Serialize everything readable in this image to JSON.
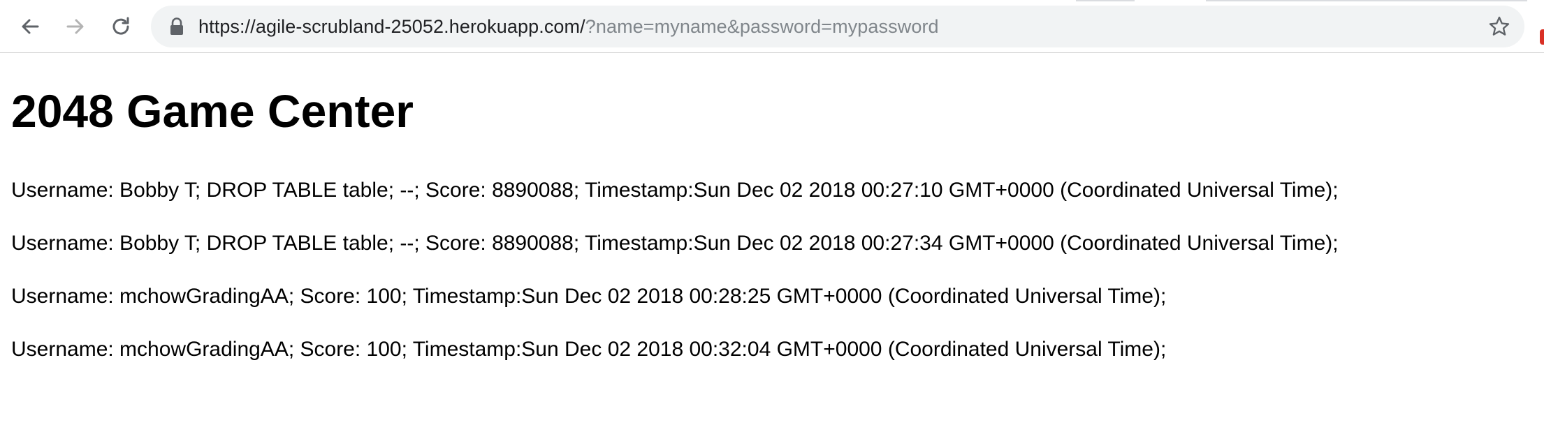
{
  "browser": {
    "url_host": "https://agile-scrubland-25052.herokuapp.com/",
    "url_query": "?name=myname&password=mypassword",
    "icons": {
      "back": "arrow-left-icon",
      "forward": "arrow-right-icon",
      "reload": "reload-icon",
      "lock": "lock-icon",
      "bookmark": "star-icon"
    },
    "colors": {
      "omnibox_bg": "#f1f3f4",
      "url_host": "#202124",
      "url_query": "#80868b",
      "icon": "#5f6368",
      "forward_disabled": "#b3b3b3",
      "badge": "#d93025"
    }
  },
  "page": {
    "title": "2048 Game Center",
    "entries": [
      "Username: Bobby T; DROP TABLE table; --; Score: 8890088; Timestamp:Sun Dec 02 2018 00:27:10 GMT+0000 (Coordinated Universal Time);",
      "Username: Bobby T; DROP TABLE table; --; Score: 8890088; Timestamp:Sun Dec 02 2018 00:27:34 GMT+0000 (Coordinated Universal Time);",
      "Username: mchowGradingAA; Score: 100; Timestamp:Sun Dec 02 2018 00:28:25 GMT+0000 (Coordinated Universal Time);",
      "Username: mchowGradingAA; Score: 100; Timestamp:Sun Dec 02 2018 00:32:04 GMT+0000 (Coordinated Universal Time);"
    ]
  }
}
